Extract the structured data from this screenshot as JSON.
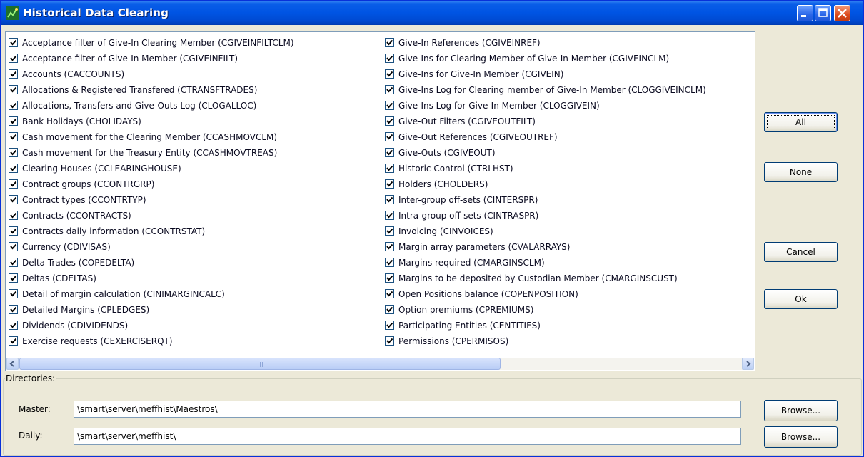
{
  "window": {
    "title": "Historical Data Clearing",
    "controls": [
      "minimize-icon",
      "maximize-icon",
      "close-icon"
    ]
  },
  "tables": {
    "checked": true,
    "column1": [
      "Acceptance filter of Give-In Clearing Member (CGIVEINFILTCLM)",
      "Acceptance filter of Give-In Member (CGIVEINFILT)",
      "Accounts (CACCOUNTS)",
      "Allocations & Registered Transfered (CTRANSFTRADES)",
      "Allocations, Transfers and Give-Outs Log (CLOGALLOC)",
      "Bank Holidays (CHOLIDAYS)",
      "Cash movement for the Clearing Member (CCASHMOVCLM)",
      "Cash movement for the Treasury Entity (CCASHMOVTREAS)",
      "Clearing Houses (CCLEARINGHOUSE)",
      "Contract groups (CCONTRGRP)",
      "Contract types (CCONTRTYP)",
      "Contracts (CCONTRACTS)",
      "Contracts daily information (CCONTRSTAT)",
      "Currency (CDIVISAS)",
      "Delta Trades (COPEDELTA)",
      "Deltas (CDELTAS)",
      "Detail of margin calculation (CINIMARGINCALC)",
      "Detailed Margins (CPLEDGES)",
      "Dividends (CDIVIDENDS)",
      "Exercise requests (CEXERCISERQT)"
    ],
    "column2": [
      "Give-In References (CGIVEINREF)",
      "Give-Ins for Clearing Member of Give-In Member (CGIVEINCLM)",
      "Give-Ins for Give-In Member (CGIVEIN)",
      "Give-Ins Log for Clearing member of Give-In Member (CLOGGIVEINCLM)",
      "Give-Ins Log for Give-In Member (CLOGGIVEIN)",
      "Give-Out Filters (CGIVEOUTFILT)",
      "Give-Out References (CGIVEOUTREF)",
      "Give-Outs (CGIVEOUT)",
      "Historic Control (CTRLHST)",
      "Holders (CHOLDERS)",
      "Inter-group off-sets (CINTERSPR)",
      "Intra-group off-sets (CINTRASPR)",
      "Invoicing (CINVOICES)",
      "Margin array parameters (CVALARRAYS)",
      "Margins required (CMARGINSCLM)",
      "Margins to be deposited by Custodian Member (CMARGINSCUST)",
      "Open Positions balance (COPENPOSITION)",
      "Option premiums (CPREMIUMS)",
      "Participating Entities (CENTITIES)",
      "Permissions (CPERMISOS)"
    ]
  },
  "buttons": {
    "all": "All",
    "none": "None",
    "cancel": "Cancel",
    "ok": "Ok",
    "browse": "Browse..."
  },
  "directories": {
    "group_label": "Directories:",
    "master_label": "Master:",
    "master_value": "\\smart\\server\\meffhist\\Maestros\\",
    "daily_label": "Daily:",
    "daily_value": "\\smart\\server\\meffhist\\"
  },
  "colors": {
    "titlebar": "#0054e3",
    "dialog_bg": "#ece9d8",
    "close_button": "#dd4b1c"
  }
}
